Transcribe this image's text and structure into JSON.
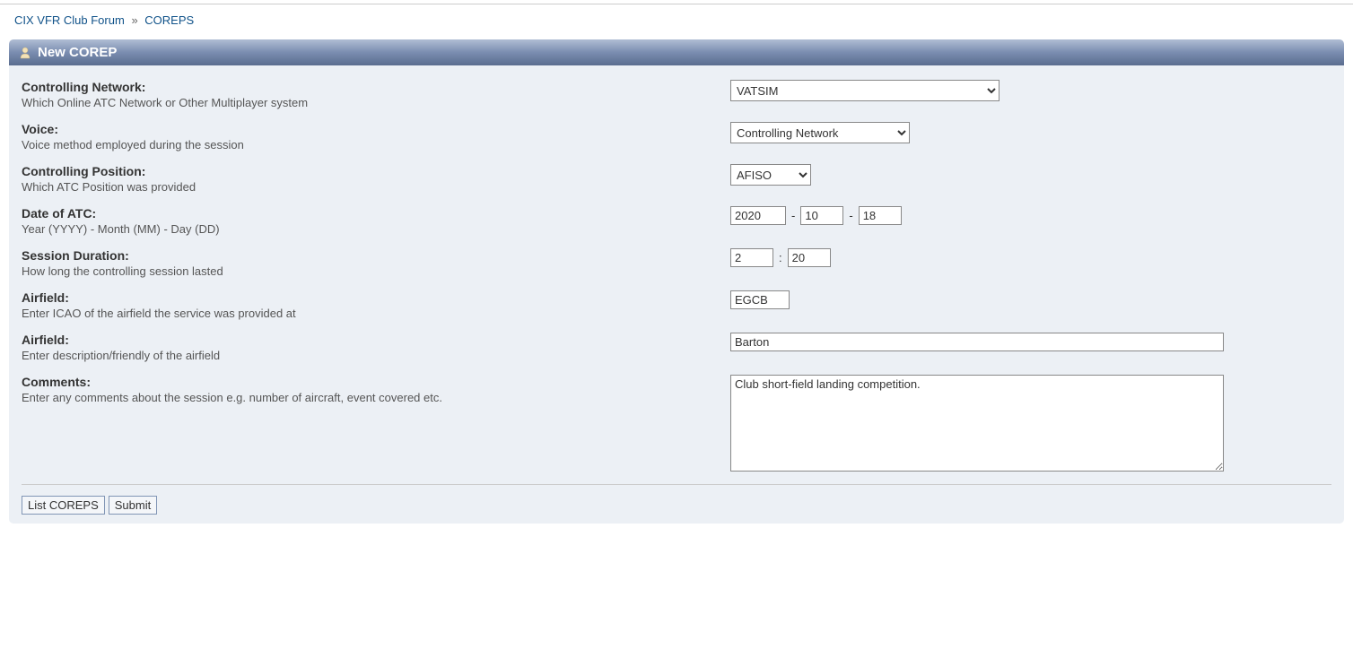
{
  "breadcrumb": {
    "root": "CIX VFR Club Forum",
    "separator": "»",
    "current": "COREPS"
  },
  "panel": {
    "title": "New COREP"
  },
  "form": {
    "network": {
      "label": "Controlling Network:",
      "desc": "Which Online ATC Network or Other Multiplayer system",
      "value": "VATSIM"
    },
    "voice": {
      "label": "Voice:",
      "desc": "Voice method employed during the session",
      "value": "Controlling Network"
    },
    "position": {
      "label": "Controlling Position:",
      "desc": "Which ATC Position was provided",
      "value": "AFISO"
    },
    "date": {
      "label": "Date of ATC:",
      "desc": "Year (YYYY) - Month (MM) - Day (DD)",
      "year": "2020",
      "month": "10",
      "day": "18",
      "sep": "-"
    },
    "duration": {
      "label": "Session Duration:",
      "desc": "How long the controlling session lasted",
      "hours": "2",
      "minutes": "20",
      "sep": ":"
    },
    "airfield_icao": {
      "label": "Airfield:",
      "desc": "Enter ICAO of the airfield the service was provided at",
      "value": "EGCB"
    },
    "airfield_name": {
      "label": "Airfield:",
      "desc": "Enter description/friendly of the airfield",
      "value": "Barton"
    },
    "comments": {
      "label": "Comments:",
      "desc": "Enter any comments about the session e.g. number of aircraft, event covered etc.",
      "value": "Club short-field landing competition."
    }
  },
  "buttons": {
    "list": "List COREPS",
    "submit": "Submit"
  }
}
